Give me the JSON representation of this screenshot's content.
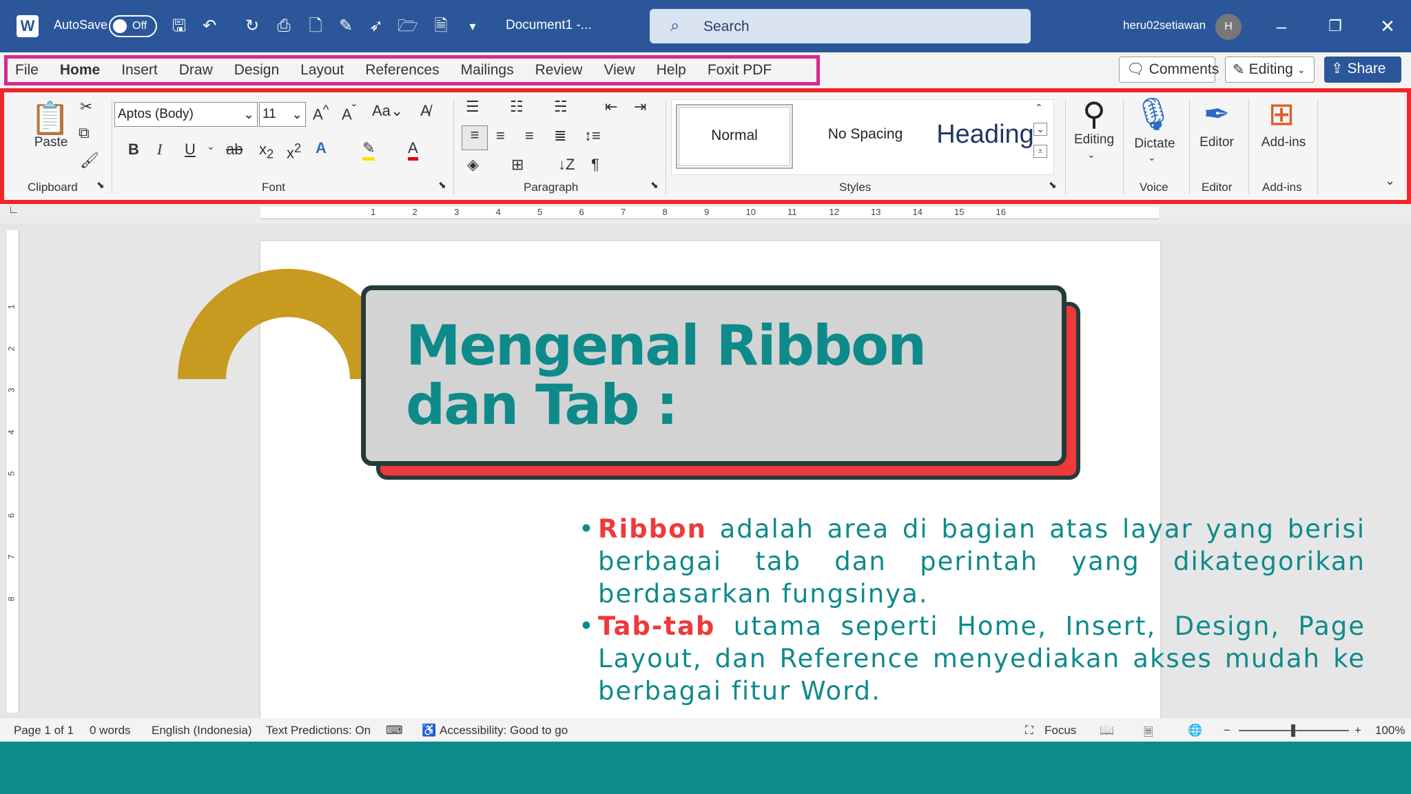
{
  "titlebar": {
    "autosave_label": "AutoSave",
    "autosave_state": "Off",
    "document_title": "Document1 -...",
    "search_placeholder": "Search",
    "username": "heru02setiawan",
    "avatar_initial": "H"
  },
  "tabs": [
    {
      "label": "File"
    },
    {
      "label": "Home",
      "active": true
    },
    {
      "label": "Insert"
    },
    {
      "label": "Draw"
    },
    {
      "label": "Design"
    },
    {
      "label": "Layout"
    },
    {
      "label": "References"
    },
    {
      "label": "Mailings"
    },
    {
      "label": "Review"
    },
    {
      "label": "View"
    },
    {
      "label": "Help"
    },
    {
      "label": "Foxit PDF"
    }
  ],
  "right_buttons": {
    "comments": "Comments",
    "editing": "Editing",
    "share": "Share"
  },
  "ribbon": {
    "clipboard": {
      "paste": "Paste",
      "group": "Clipboard"
    },
    "font": {
      "name": "Aptos (Body)",
      "size": "11",
      "group": "Font",
      "case": "Aa"
    },
    "paragraph": {
      "group": "Paragraph"
    },
    "styles": {
      "normal": "Normal",
      "no_spacing": "No Spacing",
      "heading": "Heading",
      "group": "Styles"
    },
    "editing": {
      "label": "Editing"
    },
    "voice": {
      "dictate": "Dictate",
      "group": "Voice"
    },
    "editor": {
      "label": "Editor",
      "group": "Editor"
    },
    "addins": {
      "label": "Add-ins",
      "group": "Add-ins"
    }
  },
  "ruler_numbers": [
    "1",
    "2",
    "3",
    "4",
    "5",
    "6",
    "7",
    "8",
    "9",
    "10",
    "11",
    "12",
    "13",
    "14",
    "15",
    "16"
  ],
  "vruler_numbers": [
    "1",
    "2",
    "3",
    "4",
    "5",
    "6",
    "7",
    "8"
  ],
  "document": {
    "banner_line1": "Mengenal Ribbon",
    "banner_line2": "dan Tab :",
    "bullets": [
      {
        "highlight": "Ribbon",
        "text": " adalah area di bagian atas layar yang berisi berbagai tab dan perintah yang dikategorikan berdasarkan fungsinya."
      },
      {
        "highlight": "Tab-tab",
        "text": " utama seperti Home, Insert, Design, Page Layout, dan Reference menyediakan akses mudah ke berbagai fitur Word."
      }
    ]
  },
  "statusbar": {
    "page": "Page 1 of 1",
    "words": "0 words",
    "language": "English (Indonesia)",
    "predictions": "Text Predictions: On",
    "accessibility": "Accessibility: Good to go",
    "focus": "Focus",
    "zoom": "100%"
  },
  "colors": {
    "title_bar": "#2b579a",
    "ribbon_outline": "#f0262a",
    "tabs_outline": "#d62a8f",
    "teal_text": "#0e8a8a",
    "highlight_red": "#ee3a3a"
  }
}
